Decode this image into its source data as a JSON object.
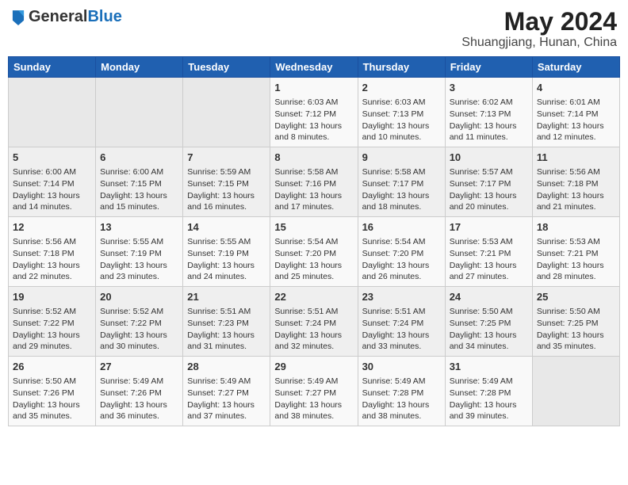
{
  "header": {
    "logo": {
      "general": "General",
      "blue": "Blue"
    },
    "title": "May 2024",
    "location": "Shuangjiang, Hunan, China"
  },
  "weekdays": [
    "Sunday",
    "Monday",
    "Tuesday",
    "Wednesday",
    "Thursday",
    "Friday",
    "Saturday"
  ],
  "weeks": [
    [
      {
        "day": "",
        "info": ""
      },
      {
        "day": "",
        "info": ""
      },
      {
        "day": "",
        "info": ""
      },
      {
        "day": "1",
        "info": "Sunrise: 6:03 AM\nSunset: 7:12 PM\nDaylight: 13 hours and 8 minutes."
      },
      {
        "day": "2",
        "info": "Sunrise: 6:03 AM\nSunset: 7:13 PM\nDaylight: 13 hours and 10 minutes."
      },
      {
        "day": "3",
        "info": "Sunrise: 6:02 AM\nSunset: 7:13 PM\nDaylight: 13 hours and 11 minutes."
      },
      {
        "day": "4",
        "info": "Sunrise: 6:01 AM\nSunset: 7:14 PM\nDaylight: 13 hours and 12 minutes."
      }
    ],
    [
      {
        "day": "5",
        "info": "Sunrise: 6:00 AM\nSunset: 7:14 PM\nDaylight: 13 hours and 14 minutes."
      },
      {
        "day": "6",
        "info": "Sunrise: 6:00 AM\nSunset: 7:15 PM\nDaylight: 13 hours and 15 minutes."
      },
      {
        "day": "7",
        "info": "Sunrise: 5:59 AM\nSunset: 7:15 PM\nDaylight: 13 hours and 16 minutes."
      },
      {
        "day": "8",
        "info": "Sunrise: 5:58 AM\nSunset: 7:16 PM\nDaylight: 13 hours and 17 minutes."
      },
      {
        "day": "9",
        "info": "Sunrise: 5:58 AM\nSunset: 7:17 PM\nDaylight: 13 hours and 18 minutes."
      },
      {
        "day": "10",
        "info": "Sunrise: 5:57 AM\nSunset: 7:17 PM\nDaylight: 13 hours and 20 minutes."
      },
      {
        "day": "11",
        "info": "Sunrise: 5:56 AM\nSunset: 7:18 PM\nDaylight: 13 hours and 21 minutes."
      }
    ],
    [
      {
        "day": "12",
        "info": "Sunrise: 5:56 AM\nSunset: 7:18 PM\nDaylight: 13 hours and 22 minutes."
      },
      {
        "day": "13",
        "info": "Sunrise: 5:55 AM\nSunset: 7:19 PM\nDaylight: 13 hours and 23 minutes."
      },
      {
        "day": "14",
        "info": "Sunrise: 5:55 AM\nSunset: 7:19 PM\nDaylight: 13 hours and 24 minutes."
      },
      {
        "day": "15",
        "info": "Sunrise: 5:54 AM\nSunset: 7:20 PM\nDaylight: 13 hours and 25 minutes."
      },
      {
        "day": "16",
        "info": "Sunrise: 5:54 AM\nSunset: 7:20 PM\nDaylight: 13 hours and 26 minutes."
      },
      {
        "day": "17",
        "info": "Sunrise: 5:53 AM\nSunset: 7:21 PM\nDaylight: 13 hours and 27 minutes."
      },
      {
        "day": "18",
        "info": "Sunrise: 5:53 AM\nSunset: 7:21 PM\nDaylight: 13 hours and 28 minutes."
      }
    ],
    [
      {
        "day": "19",
        "info": "Sunrise: 5:52 AM\nSunset: 7:22 PM\nDaylight: 13 hours and 29 minutes."
      },
      {
        "day": "20",
        "info": "Sunrise: 5:52 AM\nSunset: 7:22 PM\nDaylight: 13 hours and 30 minutes."
      },
      {
        "day": "21",
        "info": "Sunrise: 5:51 AM\nSunset: 7:23 PM\nDaylight: 13 hours and 31 minutes."
      },
      {
        "day": "22",
        "info": "Sunrise: 5:51 AM\nSunset: 7:24 PM\nDaylight: 13 hours and 32 minutes."
      },
      {
        "day": "23",
        "info": "Sunrise: 5:51 AM\nSunset: 7:24 PM\nDaylight: 13 hours and 33 minutes."
      },
      {
        "day": "24",
        "info": "Sunrise: 5:50 AM\nSunset: 7:25 PM\nDaylight: 13 hours and 34 minutes."
      },
      {
        "day": "25",
        "info": "Sunrise: 5:50 AM\nSunset: 7:25 PM\nDaylight: 13 hours and 35 minutes."
      }
    ],
    [
      {
        "day": "26",
        "info": "Sunrise: 5:50 AM\nSunset: 7:26 PM\nDaylight: 13 hours and 35 minutes."
      },
      {
        "day": "27",
        "info": "Sunrise: 5:49 AM\nSunset: 7:26 PM\nDaylight: 13 hours and 36 minutes."
      },
      {
        "day": "28",
        "info": "Sunrise: 5:49 AM\nSunset: 7:27 PM\nDaylight: 13 hours and 37 minutes."
      },
      {
        "day": "29",
        "info": "Sunrise: 5:49 AM\nSunset: 7:27 PM\nDaylight: 13 hours and 38 minutes."
      },
      {
        "day": "30",
        "info": "Sunrise: 5:49 AM\nSunset: 7:28 PM\nDaylight: 13 hours and 38 minutes."
      },
      {
        "day": "31",
        "info": "Sunrise: 5:49 AM\nSunset: 7:28 PM\nDaylight: 13 hours and 39 minutes."
      },
      {
        "day": "",
        "info": ""
      }
    ]
  ]
}
